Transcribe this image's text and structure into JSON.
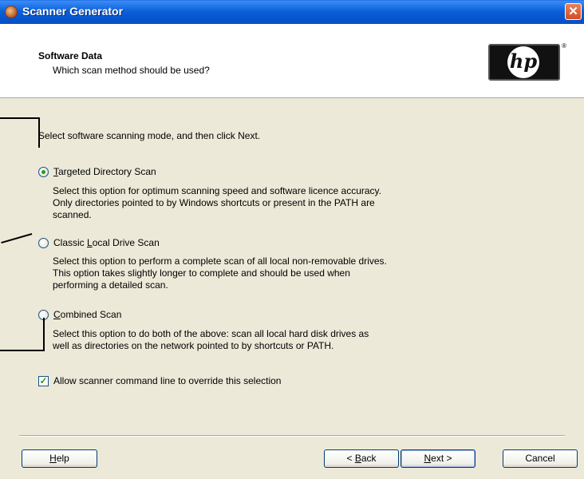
{
  "window": {
    "title": "Scanner Generator",
    "icon": "scanner-app-icon",
    "close_symbol": "✕"
  },
  "header": {
    "title": "Software Data",
    "subtitle": "Which scan method should be used?",
    "logo_text": "hp",
    "logo_mark": "®"
  },
  "instruction": "Select software scanning mode, and then click Next.",
  "options": [
    {
      "label": "Targeted Directory Scan",
      "mnemonic": "T",
      "selected": true,
      "description": [
        "Select this option for optimum scanning speed and software licence accuracy.",
        "Only directories pointed to by Windows shortcuts or present in the PATH are",
        "scanned."
      ]
    },
    {
      "label": "Classic Local Drive Scan",
      "mnemonic": "L",
      "selected": false,
      "description": [
        "Select this option to perform a complete scan of all local non-removable drives.",
        "This option takes slightly longer to complete and should be used when",
        "performing a detailed scan."
      ]
    },
    {
      "label": "Combined Scan",
      "mnemonic": "C",
      "selected": false,
      "description": [
        "Select this option to do both of the above: scan all local hard disk drives as",
        "well as directories on the network pointed to by shortcuts or PATH."
      ]
    }
  ],
  "override_checkbox": {
    "label": "Allow scanner command line to override this selection",
    "checked": true
  },
  "buttons": {
    "help": "Help",
    "back": "< Back",
    "next": "Next >",
    "cancel": "Cancel"
  },
  "colors": {
    "titlebar": "#0a5fd8",
    "dialog_bg": "#ece9d8",
    "close_button": "#d24e24",
    "radio_dot": "#21a121"
  }
}
